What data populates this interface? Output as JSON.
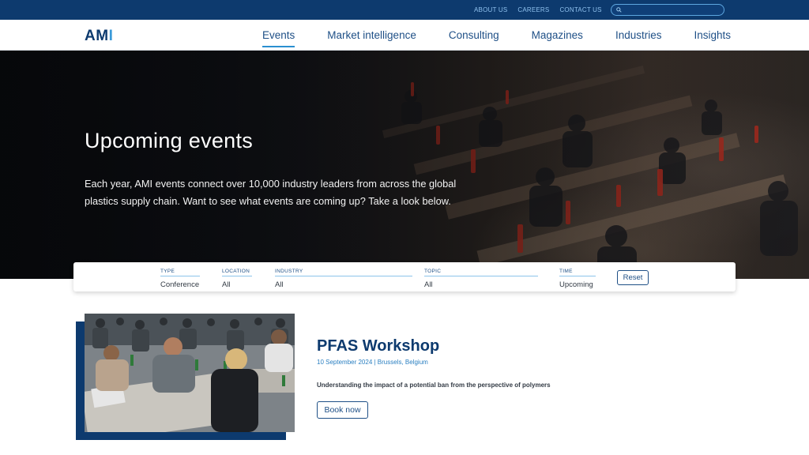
{
  "topbar": {
    "links": [
      "ABOUT US",
      "CAREERS",
      "CONTACT US"
    ],
    "search_placeholder": ""
  },
  "logo": {
    "text_prefix": "AM",
    "text_accent": "I"
  },
  "nav": {
    "items": [
      "Events",
      "Market intelligence",
      "Consulting",
      "Magazines",
      "Industries",
      "Insights"
    ],
    "active": "Events"
  },
  "hero": {
    "title": "Upcoming events",
    "text": "Each year, AMI events connect over 10,000 industry leaders from across the global plastics supply chain. Want to see what events are coming up? Take a look below."
  },
  "filters": [
    {
      "label": "TYPE",
      "value": "Conference"
    },
    {
      "label": "LOCATION",
      "value": "All"
    },
    {
      "label": "INDUSTRY",
      "value": "All"
    },
    {
      "label": "TOPIC",
      "value": "All"
    },
    {
      "label": "TIME",
      "value": "Upcoming"
    }
  ],
  "reset_label": "Reset",
  "event": {
    "title": "PFAS Workshop",
    "meta": "10 September 2024 | Brussels, Belgium",
    "description": "Understanding the impact of a potential ban from the perspective of polymers",
    "button": "Book now"
  },
  "colors": {
    "brand_navy": "#0d3a6e",
    "accent_blue": "#2a8fd0",
    "topbar_link": "#8fc1ee"
  }
}
